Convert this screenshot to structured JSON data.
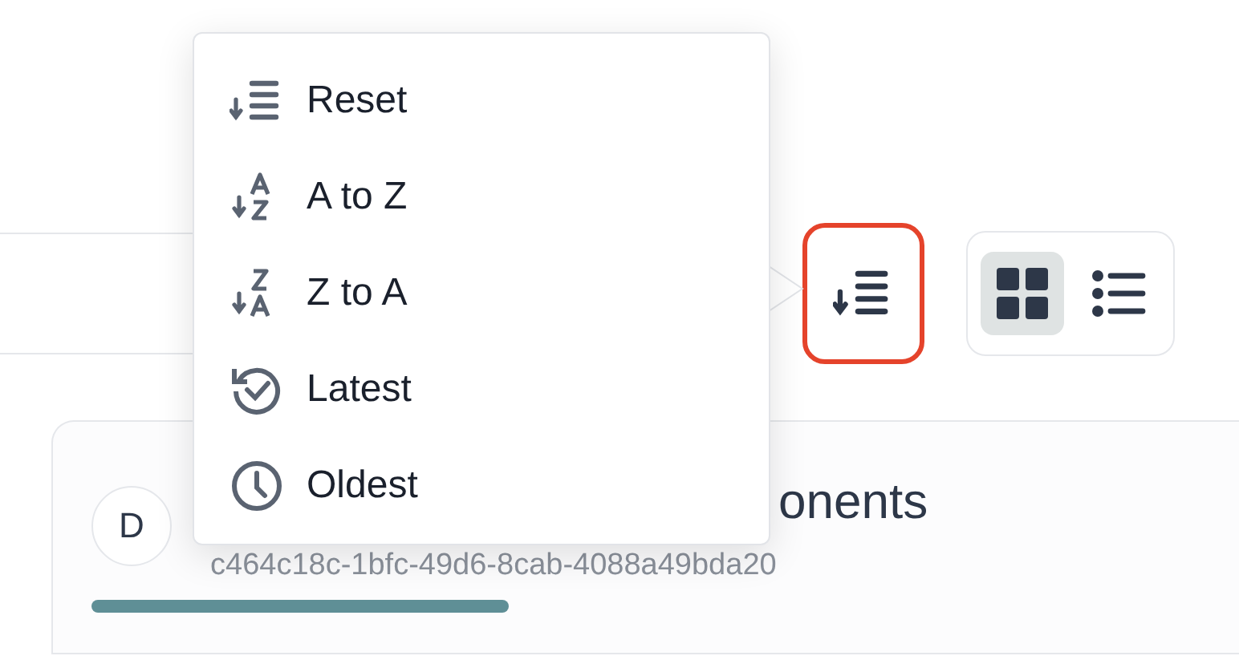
{
  "sort_menu": {
    "items": [
      {
        "kind": "reset",
        "label": "Reset"
      },
      {
        "kind": "a-z",
        "label": "A to Z"
      },
      {
        "kind": "z-a",
        "label": "Z to A"
      },
      {
        "kind": "latest",
        "label": "Latest"
      },
      {
        "kind": "oldest",
        "label": "Oldest"
      }
    ]
  },
  "sort_button": {
    "highlighted": true
  },
  "view_toggle": [
    {
      "kind": "grid",
      "selected": true
    },
    {
      "kind": "list",
      "selected": false
    }
  ],
  "card": {
    "avatar": "D",
    "title": "onents",
    "id": "c464c18c-1bfc-49d6-8cab-4088a49bda20"
  }
}
